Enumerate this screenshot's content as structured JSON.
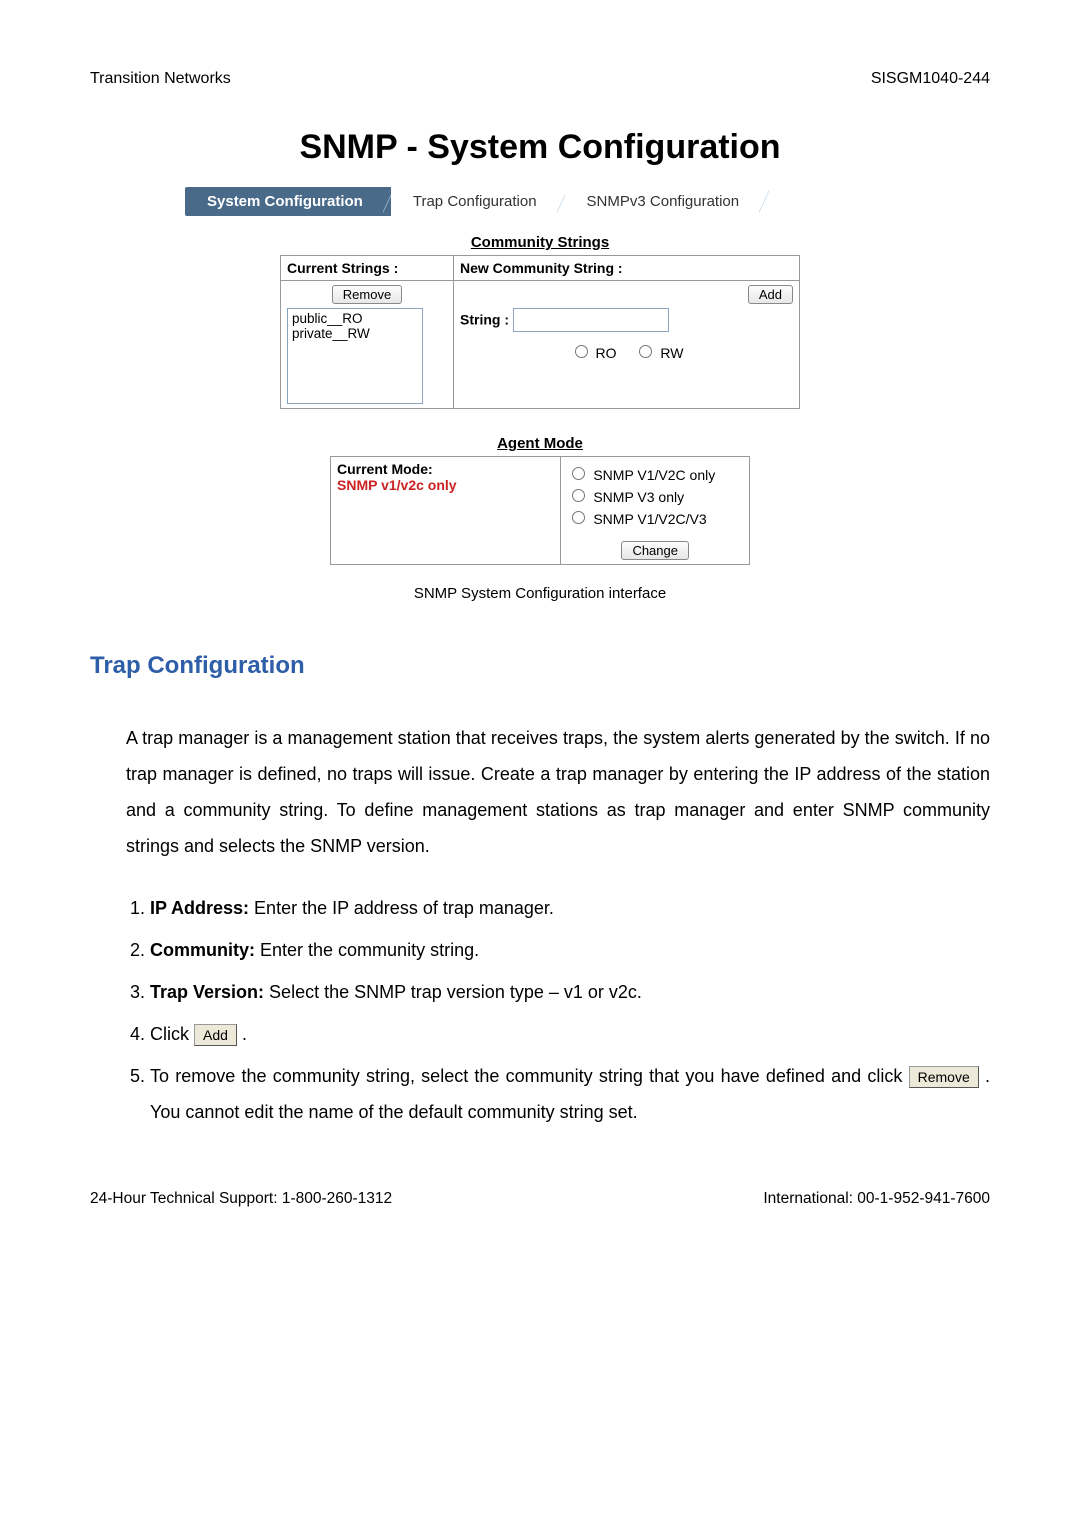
{
  "header": {
    "left": "Transition Networks",
    "right": "SISGM1040-244"
  },
  "title": "SNMP - System Configuration",
  "tabs": {
    "t0": "System Configuration",
    "t1": "Trap Configuration",
    "t2": "SNMPv3 Configuration"
  },
  "community": {
    "section_title": "Community Strings",
    "current_strings_label": "Current Strings :",
    "new_string_label": "New Community String :",
    "remove_label": "Remove",
    "add_label": "Add",
    "list": {
      "i0": "public__RO",
      "i1": "private__RW"
    },
    "string_field_label": "String :",
    "ro_label": "RO",
    "rw_label": "RW"
  },
  "agent": {
    "section_title": "Agent Mode",
    "current_mode_label": "Current Mode:",
    "current_mode_value": "SNMP v1/v2c only",
    "opt0": "SNMP V1/V2C only",
    "opt1": "SNMP V3 only",
    "opt2": "SNMP V1/V2C/V3",
    "change_label": "Change"
  },
  "caption": "SNMP System Configuration interface",
  "section_heading": "Trap Configuration",
  "paragraph": "A trap manager is a management station that receives traps, the system alerts generated by the switch. If no trap manager is defined, no traps will issue. Create a trap manager by entering the IP address of the station and a community string. To define management stations as trap manager and enter SNMP community strings and selects the SNMP version.",
  "steps": {
    "s1_label": "IP Address:",
    "s1_text": " Enter the IP address of trap manager.",
    "s2_label": "Community:",
    "s2_text": " Enter the community string.",
    "s3_label": "Trap Version:",
    "s3_text": " Select the SNMP trap version type – v1 or v2c.",
    "s4_pre": "Click ",
    "s4_btn": "Add",
    "s4_post": " .",
    "s5_pre": "To remove the community string, select the community string that you have defined and click ",
    "s5_btn": "Remove",
    "s5_post": " . You cannot edit the name of the default community string set."
  },
  "footer": {
    "left": "24-Hour Technical Support: 1-800-260-1312",
    "right": "International: 00-1-952-941-7600"
  }
}
